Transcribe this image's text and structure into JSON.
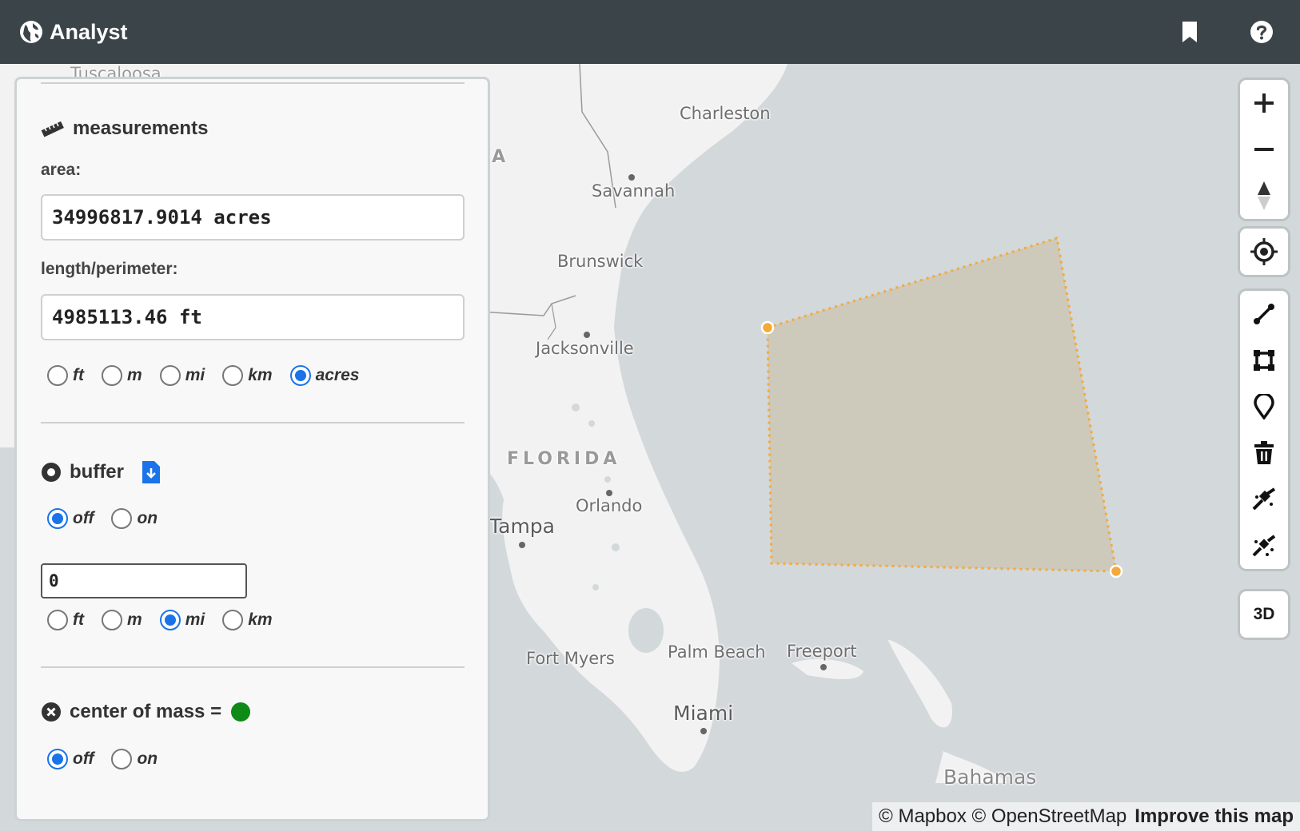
{
  "header": {
    "title": "Analyst",
    "bookmark_icon": "bookmark-icon",
    "help_icon": "help-icon",
    "background": "#3b4449"
  },
  "map": {
    "labels": {
      "tuscaloosa": "Tuscaloosa",
      "charleston": "Charleston",
      "savannah": "Savannah",
      "brunswick": "Brunswick",
      "jacksonville": "Jacksonville",
      "florida": "FLORIDA",
      "orlando": "Orlando",
      "tampa": "Tampa",
      "fort_myers": "Fort Myers",
      "palm_beach": "Palm Beach",
      "freeport": "Freeport",
      "miami": "Miami",
      "bahamas": "Bahamas",
      "ia": "IA"
    },
    "polygon_color": "#f5a93a",
    "attribution": {
      "mapbox": "© Mapbox",
      "osm": "© OpenStreetMap",
      "improve": "Improve this map"
    }
  },
  "controls": {
    "zoom_in": "plus-icon",
    "zoom_out": "minus-icon",
    "compass": "compass-icon",
    "locate": "locate-icon",
    "draw_line": "line-icon",
    "draw_polygon": "polygon-icon",
    "draw_point": "marker-icon",
    "trash": "trash-icon",
    "combine": "combine-icon",
    "uncombine": "uncombine-icon",
    "three_d": "3D"
  },
  "panel": {
    "measurements": {
      "title": "measurements",
      "area_label": "area:",
      "area_value": "34996817.9014 acres",
      "length_label": "length/perimeter:",
      "length_value": "4985113.46 ft",
      "units": [
        "ft",
        "m",
        "mi",
        "km",
        "acres"
      ],
      "selected_unit": "acres"
    },
    "buffer": {
      "title": "buffer",
      "toggle": [
        "off",
        "on"
      ],
      "selected": "off",
      "value": "0",
      "units": [
        "ft",
        "m",
        "mi",
        "km"
      ],
      "selected_unit": "mi"
    },
    "center_of_mass": {
      "title": "center of mass =",
      "toggle": [
        "off",
        "on"
      ],
      "selected": "off",
      "dot_color": "#0e8a16"
    }
  }
}
